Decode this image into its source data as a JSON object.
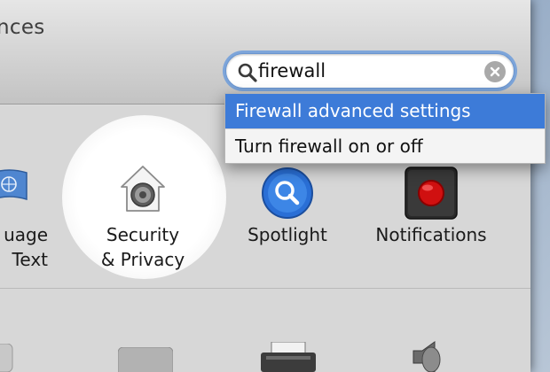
{
  "window": {
    "title": "nces"
  },
  "search": {
    "value": "firewall",
    "placeholder": ""
  },
  "suggestions": [
    {
      "label": "Firewall advanced settings",
      "selected": true
    },
    {
      "label": "Turn firewall on or off",
      "selected": false
    }
  ],
  "prefs": {
    "language": {
      "label": "uage\nText",
      "icon": "flag-icon"
    },
    "security": {
      "label": "Security\n& Privacy",
      "icon": "house-lock-icon"
    },
    "spotlight": {
      "label": "Spotlight",
      "icon": "magnifier-icon"
    },
    "notifications": {
      "label": "Notifications",
      "icon": "record-icon"
    }
  },
  "colors": {
    "accent": "#3d7bd8",
    "focus_ring": "#6096dc",
    "notification_red": "#d01010",
    "spotlight_blue": "#2a6fd6"
  }
}
